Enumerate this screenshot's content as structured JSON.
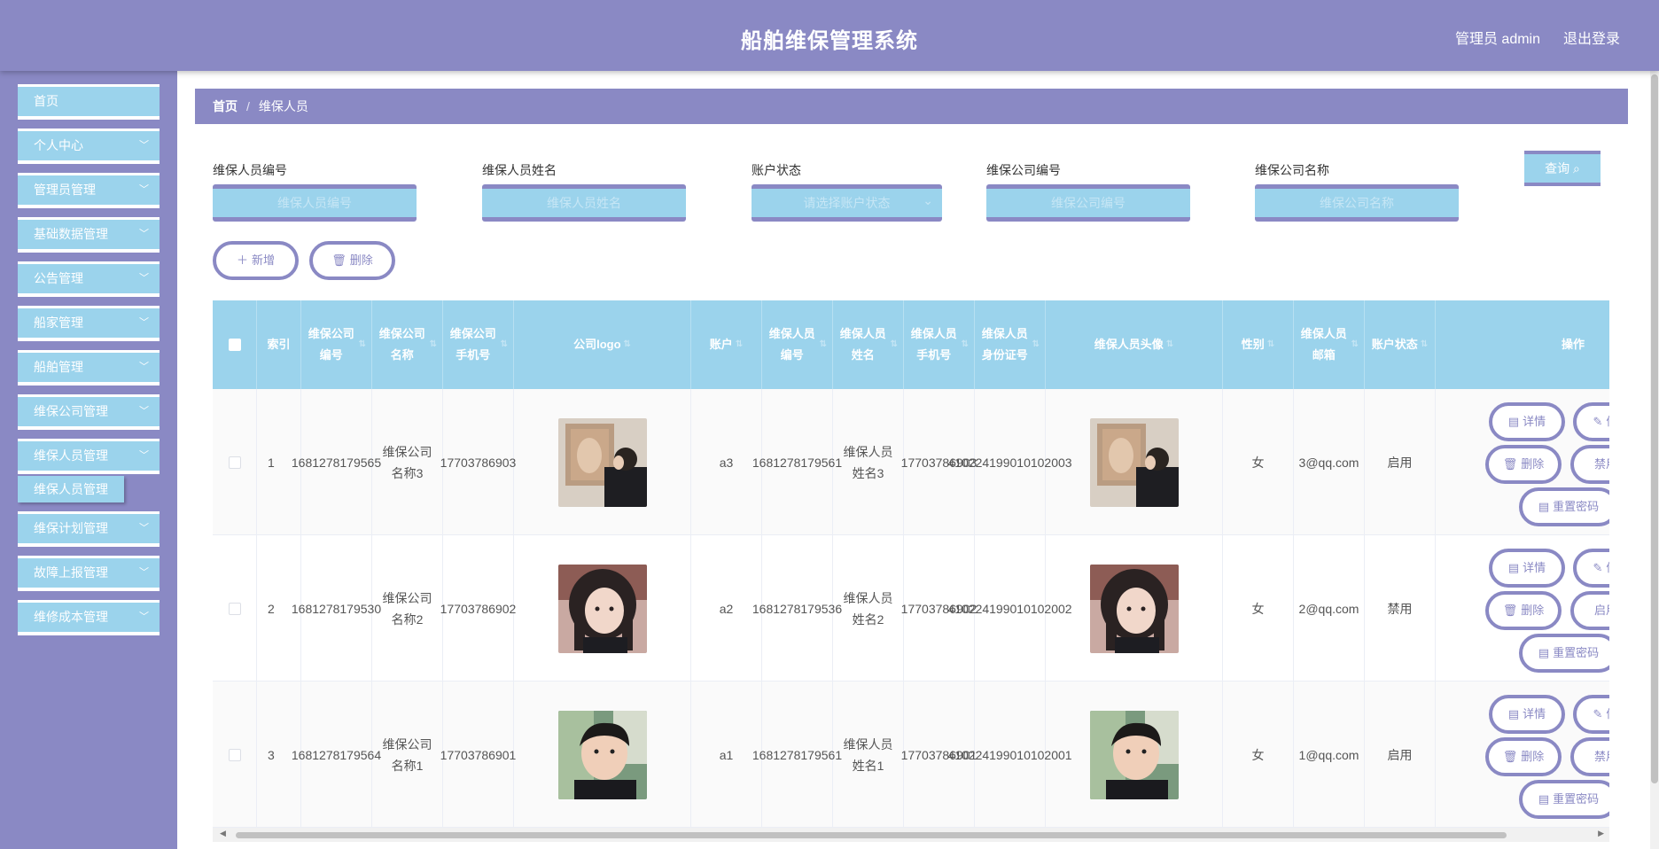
{
  "app": {
    "title": "船舶维保管理系统",
    "user": "管理员 admin",
    "logout": "退出登录"
  },
  "sidebar": {
    "home": "首页",
    "items": [
      "个人中心",
      "管理员管理",
      "基础数据管理",
      "公告管理",
      "船家管理",
      "船舶管理",
      "维保公司管理",
      "维保人员管理"
    ],
    "active_sub": "维保人员管理",
    "items_after": [
      "维保计划管理",
      "故障上报管理",
      "维修成本管理"
    ]
  },
  "breadcrumb": {
    "home": "首页",
    "sep": "/",
    "current": "维保人员"
  },
  "search": {
    "fields": [
      {
        "label": "维保人员编号",
        "placeholder": "维保人员编号"
      },
      {
        "label": "维保人员姓名",
        "placeholder": "维保人员姓名"
      },
      {
        "label": "账户状态",
        "placeholder": "请选择账户状态"
      },
      {
        "label": "维保公司编号",
        "placeholder": "维保公司编号"
      },
      {
        "label": "维保公司名称",
        "placeholder": "维保公司名称"
      }
    ],
    "query": "查询"
  },
  "toolbar": {
    "add": "新增",
    "delete": "删除"
  },
  "table": {
    "headers": {
      "index": "索引",
      "company_no": "维保公司编号",
      "company_name": "维保公司名称",
      "company_phone": "维保公司手机号",
      "logo": "公司logo",
      "account": "账户",
      "staff_no": "维保人员编号",
      "staff_name": "维保人员姓名",
      "staff_phone": "维保人员手机号",
      "staff_id": "维保人员身份证号",
      "staff_avatar": "维保人员头像",
      "gender": "性别",
      "email": "维保人员邮箱",
      "status": "账户状态",
      "ops": "操作"
    },
    "rows": [
      {
        "index": "1",
        "company_no": "1681278179565",
        "company_name": "维保公司名称3",
        "company_phone": "17703786903",
        "account": "a3",
        "staff_no": "1681278179561",
        "staff_name": "维保人员姓名3",
        "staff_phone": "17703786903",
        "staff_id": "410224199010102003",
        "gender": "女",
        "email": "3@qq.com",
        "status": "启用",
        "toggle": "禁用",
        "img": "woman-art"
      },
      {
        "index": "2",
        "company_no": "1681278179530",
        "company_name": "维保公司名称2",
        "company_phone": "17703786902",
        "account": "a2",
        "staff_no": "1681278179536",
        "staff_name": "维保人员姓名2",
        "staff_phone": "17703786902",
        "staff_id": "410224199010102002",
        "gender": "女",
        "email": "2@qq.com",
        "status": "禁用",
        "toggle": "启用",
        "img": "girl-portrait"
      },
      {
        "index": "3",
        "company_no": "1681278179564",
        "company_name": "维保公司名称1",
        "company_phone": "17703786901",
        "account": "a1",
        "staff_no": "1681278179561",
        "staff_name": "维保人员姓名1",
        "staff_phone": "17703786901",
        "staff_id": "410224199010102001",
        "gender": "女",
        "email": "1@qq.com",
        "status": "启用",
        "toggle": "禁用",
        "img": "man-portrait"
      }
    ],
    "actions": {
      "detail": "详情",
      "edit": "修改",
      "delete": "删除",
      "reset": "重置密码"
    }
  },
  "colors": {
    "primary": "#8a89c4",
    "accent": "#9bd3ec"
  }
}
